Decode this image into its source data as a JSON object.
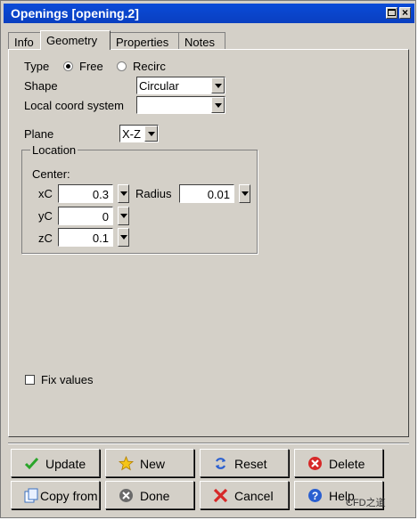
{
  "window": {
    "title": "Openings [opening.2]",
    "close_glyph": "×"
  },
  "tabs": [
    "Info",
    "Geometry",
    "Properties",
    "Notes"
  ],
  "geometry": {
    "type_label": "Type",
    "type_options": [
      "Free",
      "Recirc"
    ],
    "type_selected": "Free",
    "shape_label": "Shape",
    "shape_value": "Circular",
    "local_coord_label": "Local coord system",
    "local_coord_value": "",
    "plane_label": "Plane",
    "plane_value": "X-Z",
    "location_title": "Location",
    "center_label": "Center:",
    "xc_label": "xC",
    "xc_value": "0.3",
    "yc_label": "yC",
    "yc_value": "0",
    "zc_label": "zC",
    "zc_value": "0.1",
    "radius_label": "Radius",
    "radius_value": "0.01",
    "fix_values_label": "Fix values",
    "fix_values_checked": false
  },
  "buttons": {
    "update": "Update",
    "new": "New",
    "reset": "Reset",
    "delete": "Delete",
    "copy_from": "Copy from",
    "done": "Done",
    "cancel": "Cancel",
    "help": "Help"
  },
  "watermark": "CFD之道",
  "colors": {
    "title_bar": "#0a3fc0",
    "face": "#d4d0c8"
  }
}
